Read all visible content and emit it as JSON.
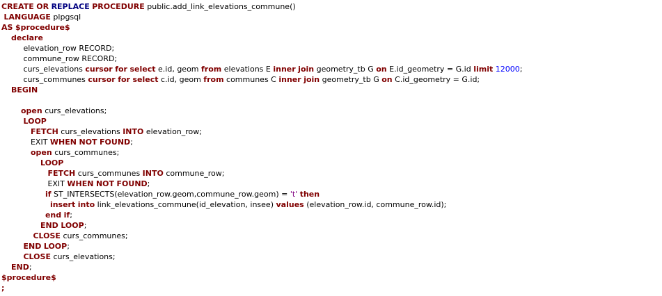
{
  "editor": {
    "language": "plpgsql",
    "colors": {
      "keyword": "#800000",
      "keyword_alt": "#000080",
      "number": "#0000ff",
      "string": "#800080",
      "text": "#000000",
      "background": "#ffffff"
    },
    "lines": [
      {
        "indent": "",
        "tokens": [
          {
            "t": "CREATE",
            "c": "kw"
          },
          {
            "t": " "
          },
          {
            "t": "OR",
            "c": "kw"
          },
          {
            "t": " "
          },
          {
            "t": "REPLACE",
            "c": "kw2"
          },
          {
            "t": " "
          },
          {
            "t": "PROCEDURE",
            "c": "kw"
          },
          {
            "t": " public.add_link_elevations_commune()"
          }
        ]
      },
      {
        "indent": " ",
        "tokens": [
          {
            "t": "LANGUAGE",
            "c": "kw"
          },
          {
            "t": " plpgsql"
          }
        ]
      },
      {
        "indent": "",
        "tokens": [
          {
            "t": "AS",
            "c": "kw"
          },
          {
            "t": " "
          },
          {
            "t": "$procedure$",
            "c": "kw"
          }
        ]
      },
      {
        "indent": "    ",
        "tokens": [
          {
            "t": "declare",
            "c": "kw"
          }
        ]
      },
      {
        "indent": "         ",
        "tokens": [
          {
            "t": "elevation_row RECORD;"
          }
        ]
      },
      {
        "indent": "         ",
        "tokens": [
          {
            "t": "commune_row RECORD;"
          }
        ]
      },
      {
        "indent": "         ",
        "tokens": [
          {
            "t": "curs_elevations "
          },
          {
            "t": "cursor",
            "c": "kw"
          },
          {
            "t": " "
          },
          {
            "t": "for",
            "c": "kw"
          },
          {
            "t": " "
          },
          {
            "t": "select",
            "c": "kw"
          },
          {
            "t": " e.id, geom "
          },
          {
            "t": "from",
            "c": "kw"
          },
          {
            "t": " elevations E "
          },
          {
            "t": "inner",
            "c": "kw"
          },
          {
            "t": " "
          },
          {
            "t": "join",
            "c": "kw"
          },
          {
            "t": " geometry_tb G "
          },
          {
            "t": "on",
            "c": "kw"
          },
          {
            "t": " E.id_geometry = G.id "
          },
          {
            "t": "limit",
            "c": "kw"
          },
          {
            "t": " "
          },
          {
            "t": "12000",
            "c": "num"
          },
          {
            "t": ";"
          }
        ]
      },
      {
        "indent": "         ",
        "tokens": [
          {
            "t": "curs_communes "
          },
          {
            "t": "cursor",
            "c": "kw"
          },
          {
            "t": " "
          },
          {
            "t": "for",
            "c": "kw"
          },
          {
            "t": " "
          },
          {
            "t": "select",
            "c": "kw"
          },
          {
            "t": " c.id, geom "
          },
          {
            "t": "from",
            "c": "kw"
          },
          {
            "t": " communes C "
          },
          {
            "t": "inner",
            "c": "kw"
          },
          {
            "t": " "
          },
          {
            "t": "join",
            "c": "kw"
          },
          {
            "t": " geometry_tb G "
          },
          {
            "t": "on",
            "c": "kw"
          },
          {
            "t": " C.id_geometry = G.id;"
          }
        ]
      },
      {
        "indent": "    ",
        "tokens": [
          {
            "t": "BEGIN",
            "c": "kw"
          }
        ]
      },
      {
        "indent": "",
        "tokens": []
      },
      {
        "indent": "        ",
        "tokens": [
          {
            "t": "open",
            "c": "kw"
          },
          {
            "t": " curs_elevations;"
          }
        ]
      },
      {
        "indent": "         ",
        "tokens": [
          {
            "t": "LOOP",
            "c": "kw"
          }
        ]
      },
      {
        "indent": "            ",
        "tokens": [
          {
            "t": "FETCH",
            "c": "kw"
          },
          {
            "t": " curs_elevations "
          },
          {
            "t": "INTO",
            "c": "kw"
          },
          {
            "t": " elevation_row;"
          }
        ]
      },
      {
        "indent": "            ",
        "tokens": [
          {
            "t": "EXIT "
          },
          {
            "t": "WHEN",
            "c": "kw"
          },
          {
            "t": " "
          },
          {
            "t": "NOT",
            "c": "kw"
          },
          {
            "t": " "
          },
          {
            "t": "FOUND",
            "c": "kw"
          },
          {
            "t": ";"
          }
        ]
      },
      {
        "indent": "            ",
        "tokens": [
          {
            "t": "open",
            "c": "kw"
          },
          {
            "t": " curs_communes;"
          }
        ]
      },
      {
        "indent": "                ",
        "tokens": [
          {
            "t": "LOOP",
            "c": "kw"
          }
        ]
      },
      {
        "indent": "                   ",
        "tokens": [
          {
            "t": "FETCH",
            "c": "kw"
          },
          {
            "t": " curs_communes "
          },
          {
            "t": "INTO",
            "c": "kw"
          },
          {
            "t": " commune_row;"
          }
        ]
      },
      {
        "indent": "                   ",
        "tokens": [
          {
            "t": "EXIT "
          },
          {
            "t": "WHEN",
            "c": "kw"
          },
          {
            "t": " "
          },
          {
            "t": "NOT",
            "c": "kw"
          },
          {
            "t": " "
          },
          {
            "t": "FOUND",
            "c": "kw"
          },
          {
            "t": ";"
          }
        ]
      },
      {
        "indent": "                  ",
        "tokens": [
          {
            "t": "if",
            "c": "kw"
          },
          {
            "t": " ST_INTERSECTS(elevation_row.geom,commune_row.geom) = "
          },
          {
            "t": "'t'",
            "c": "str"
          },
          {
            "t": " "
          },
          {
            "t": "then",
            "c": "kw"
          }
        ]
      },
      {
        "indent": "                    ",
        "tokens": [
          {
            "t": "insert",
            "c": "kw"
          },
          {
            "t": " "
          },
          {
            "t": "into",
            "c": "kw"
          },
          {
            "t": " link_elevations_commune(id_elevation, insee) "
          },
          {
            "t": "values",
            "c": "kw"
          },
          {
            "t": " (elevation_row.id, commune_row.id);"
          }
        ]
      },
      {
        "indent": "                  ",
        "tokens": [
          {
            "t": "end",
            "c": "kw"
          },
          {
            "t": " "
          },
          {
            "t": "if",
            "c": "kw"
          },
          {
            "t": ";"
          }
        ]
      },
      {
        "indent": "                ",
        "tokens": [
          {
            "t": "END",
            "c": "kw"
          },
          {
            "t": " "
          },
          {
            "t": "LOOP",
            "c": "kw"
          },
          {
            "t": ";"
          }
        ]
      },
      {
        "indent": "             ",
        "tokens": [
          {
            "t": "CLOSE",
            "c": "kw"
          },
          {
            "t": " curs_communes;"
          }
        ]
      },
      {
        "indent": "         ",
        "tokens": [
          {
            "t": "END",
            "c": "kw"
          },
          {
            "t": " "
          },
          {
            "t": "LOOP",
            "c": "kw"
          },
          {
            "t": ";"
          }
        ]
      },
      {
        "indent": "         ",
        "tokens": [
          {
            "t": "CLOSE",
            "c": "kw"
          },
          {
            "t": " curs_elevations;"
          }
        ]
      },
      {
        "indent": "    ",
        "tokens": [
          {
            "t": "END",
            "c": "kw"
          },
          {
            "t": ";"
          }
        ]
      },
      {
        "indent": "",
        "tokens": [
          {
            "t": "$procedure$",
            "c": "kw"
          }
        ]
      },
      {
        "indent": "",
        "tokens": [
          {
            "t": ";",
            "c": "kw"
          }
        ]
      }
    ]
  }
}
